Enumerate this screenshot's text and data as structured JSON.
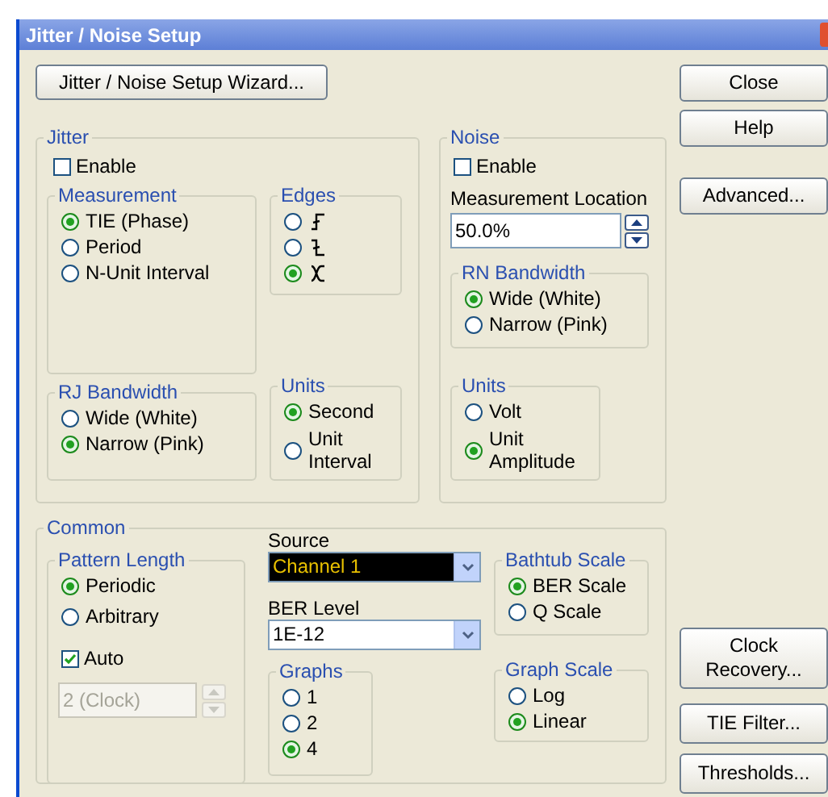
{
  "window": {
    "title": "Jitter / Noise Setup"
  },
  "wizard_button": "Jitter / Noise Setup Wizard...",
  "side_buttons_top": [
    "Close",
    "Help",
    "Advanced..."
  ],
  "jitter": {
    "title": "Jitter",
    "enable": {
      "label": "Enable",
      "checked": false
    },
    "measurement": {
      "title": "Measurement",
      "options": [
        {
          "label": "TIE (Phase)",
          "selected": true
        },
        {
          "label": "Period",
          "selected": false
        },
        {
          "label": "N-Unit Interval",
          "selected": false
        }
      ]
    },
    "edges": {
      "title": "Edges",
      "options": [
        {
          "kind": "rising",
          "selected": false
        },
        {
          "kind": "falling",
          "selected": false
        },
        {
          "kind": "both",
          "selected": true
        }
      ]
    },
    "rj_bandwidth": {
      "title": "RJ Bandwidth",
      "options": [
        {
          "label": "Wide (White)",
          "selected": false
        },
        {
          "label": "Narrow (Pink)",
          "selected": true
        }
      ]
    },
    "units": {
      "title": "Units",
      "options": [
        {
          "label": "Second",
          "selected": true
        },
        {
          "label": "Unit Interval",
          "selected": false
        }
      ]
    }
  },
  "noise": {
    "title": "Noise",
    "enable": {
      "label": "Enable",
      "checked": false
    },
    "measurement_location": {
      "label": "Measurement Location",
      "value": "50.0%"
    },
    "rn_bandwidth": {
      "title": "RN Bandwidth",
      "options": [
        {
          "label": "Wide (White)",
          "selected": true
        },
        {
          "label": "Narrow (Pink)",
          "selected": false
        }
      ]
    },
    "units": {
      "title": "Units",
      "options": [
        {
          "label": "Volt",
          "selected": false
        },
        {
          "label": "Unit Amplitude",
          "selected": true
        }
      ]
    }
  },
  "common": {
    "title": "Common",
    "pattern_length": {
      "title": "Pattern Length",
      "options": [
        {
          "label": "Periodic",
          "selected": true
        },
        {
          "label": "Arbitrary",
          "selected": false
        }
      ],
      "auto": {
        "label": "Auto",
        "checked": true
      },
      "count": {
        "value": "2 (Clock)",
        "disabled": true
      }
    },
    "source": {
      "label": "Source",
      "value": "Channel 1"
    },
    "ber_level": {
      "label": "BER Level",
      "value": "1E-12"
    },
    "graphs": {
      "title": "Graphs",
      "options": [
        {
          "label": "1",
          "selected": false
        },
        {
          "label": "2",
          "selected": false
        },
        {
          "label": "4",
          "selected": true
        }
      ]
    },
    "bathtub_scale": {
      "title": "Bathtub Scale",
      "options": [
        {
          "label": "BER Scale",
          "selected": true
        },
        {
          "label": "Q Scale",
          "selected": false
        }
      ]
    },
    "graph_scale": {
      "title": "Graph Scale",
      "options": [
        {
          "label": "Log",
          "selected": false
        },
        {
          "label": "Linear",
          "selected": true
        }
      ]
    }
  },
  "side_buttons_bottom": [
    "Clock Recovery...",
    "TIE Filter...",
    "Thresholds..."
  ]
}
